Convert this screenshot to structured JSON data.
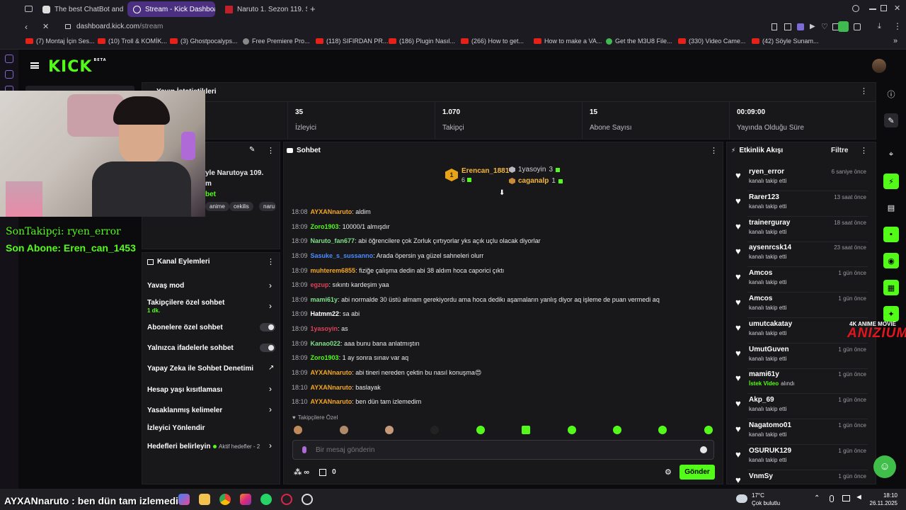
{
  "browser": {
    "tabs": [
      {
        "label": "The best ChatBot and Wi"
      },
      {
        "label": "Stream - Kick Dashboard"
      },
      {
        "label": "Naruto 1. Sezon 119. S"
      }
    ],
    "url_host": "dashboard.kick.com",
    "url_path": "/stream",
    "bookmarks": [
      "(7) Montaj İçin Ses...",
      "(10) Troll & KOMİK...",
      "(3) Ghostpocalyps...",
      "Free Premiere Pro...",
      "(118) SIFIRDAN PR...",
      "(186) Plugin Nasıl...",
      "(266) How to get...",
      "How to make a VA...",
      "Get the M3U8 File...",
      "(330) Video Came...",
      "(42) Söyle Sunam..."
    ]
  },
  "kick": {
    "logo": "KICK",
    "logo_beta": "BETA"
  },
  "stats": {
    "title": "Yayın İstatistikleri",
    "items": [
      {
        "value": "35",
        "label": "İzleyici"
      },
      {
        "value": "1.070",
        "label": "Takipçi"
      },
      {
        "value": "15",
        "label": "Abone Sayısı"
      },
      {
        "value": "00:09:00",
        "label": "Yayında Olduğu Süre"
      }
    ]
  },
  "stream_info": {
    "title_part": "yle Narutoya 109.",
    "title_part2": "m",
    "category_part": "bet",
    "tags": [
      "anime",
      "cekilis",
      "naru"
    ]
  },
  "overlay": {
    "last_follower": "SonTakipçi: ryen_error",
    "last_sub": "Son Abone: Eren_can_1453",
    "last_chat": "AYXANnaruto : ben dün tam izlemedim"
  },
  "chat": {
    "title": "Sohbet",
    "leaders": [
      {
        "rank": "1",
        "name": "Erencan_1881",
        "count": "6"
      },
      {
        "name": "1yasoyin",
        "count": "3"
      },
      {
        "name": "caganalp",
        "count": "1"
      }
    ],
    "messages": [
      {
        "time": "18:08",
        "user": "AYXANnaruto",
        "color": "#f5a623",
        "text": "aldim"
      },
      {
        "time": "18:09",
        "user": "Zoro1903",
        "color": "#53fc18",
        "text": "10000/1 almışdır"
      },
      {
        "time": "18:09",
        "user": "Naruto_fan677",
        "color": "#7ee08a",
        "text": "abi öğrencilere çok Zorluk çırtıyorlar yks açık uçlu olacak diyorlar"
      },
      {
        "time": "18:09",
        "user": "Sasuke_s_sussanno",
        "color": "#4a8cff",
        "text": "Arada öpersin ya güzel sahneleri olurr"
      },
      {
        "time": "18:09",
        "user": "muhterem6855",
        "color": "#f5a623",
        "text": "fiziğe çalışma dedin abi 38 aldım hoca caporici çıktı"
      },
      {
        "time": "18:09",
        "user": "egzup",
        "color": "#e0405a",
        "text": "sıkıntı kardeşim yaa"
      },
      {
        "time": "18:09",
        "user": "mami61y",
        "color": "#7ee08a",
        "text": "abi normalde 30 üstü almam gerekiyordu ama hoca dedikı aşamaların yanlış diyor aq işleme de puan vermedi aq"
      },
      {
        "time": "18:09",
        "user": "Hatmm22",
        "color": "#ffffff",
        "text": "sa abi"
      },
      {
        "time": "18:09",
        "user": "1yasoyin",
        "color": "#e0405a",
        "text": "as"
      },
      {
        "time": "18:09",
        "user": "Kanao022",
        "color": "#7ee08a",
        "text": "aaa bunu bana anlatmıştın"
      },
      {
        "time": "18:09",
        "user": "Zoro1903",
        "color": "#53fc18",
        "text": "1 ay sonra sınav var aq"
      },
      {
        "time": "18:09",
        "user": "AYXANnaruto",
        "color": "#f5a623",
        "text": "abi tineri nereden çektin bu nasıl konuşma😍"
      },
      {
        "time": "18:10",
        "user": "AYXANnaruto",
        "color": "#f5a623",
        "text": "baslayak"
      },
      {
        "time": "18:10",
        "user": "AYXANnaruto",
        "color": "#f5a623",
        "text": "ben dün tam izlemedim"
      }
    ],
    "followers_only": "Takipçilere Özel",
    "placeholder": "Bir mesaj gönderin",
    "points": "0",
    "send": "Gönder"
  },
  "actions": {
    "title": "Kanal Eylemleri",
    "items": [
      {
        "label": "Yavaş mod"
      },
      {
        "label": "Takipçilere özel sohbet",
        "sub": "1 dk."
      },
      {
        "label": "Abonelere özel sohbet"
      },
      {
        "label": "Yalnızca ifadelerle sohbet"
      },
      {
        "label": "Yapay Zeka ile Sohbet Denetimi"
      },
      {
        "label": "Hesap yaşı kısıtlaması"
      },
      {
        "label": "Yasaklanmış kelimeler"
      },
      {
        "label": "İzleyici Yönlendir"
      },
      {
        "label": "Hedefleri belirleyin",
        "sub": "Aktif hedefler - 2"
      }
    ]
  },
  "feed": {
    "title": "Etkinlik Akışı",
    "filter": "Filtre",
    "items": [
      {
        "name": "ryen_error",
        "desc": "kanalı takip etti",
        "time": "6 saniye önce"
      },
      {
        "name": "Rarer123",
        "desc": "kanalı takip etti",
        "time": "13 saat önce"
      },
      {
        "name": "trainerguray",
        "desc": "kanalı takip etti",
        "time": "18 saat önce"
      },
      {
        "name": "aysenrcsk14",
        "desc": "kanalı takip etti",
        "time": "23 saat önce"
      },
      {
        "name": "Amcos",
        "desc": "kanalı takip etti",
        "time": "1 gün önce"
      },
      {
        "name": "Amcos",
        "desc": "kanalı takip etti",
        "time": "1 gün önce"
      },
      {
        "name": "umutcakatay",
        "desc": "kanalı takip etti",
        "time": ""
      },
      {
        "name": "UmutGuven",
        "desc": "kanalı takip etti",
        "time": "1 gün önce"
      },
      {
        "name": "mami61y",
        "desc_green": "İstek Video",
        "desc": "alındı",
        "time": "1 gün önce"
      },
      {
        "name": "Akp_69",
        "desc": "kanalı takip etti",
        "time": "1 gün önce"
      },
      {
        "name": "Nagatomo01",
        "desc": "kanalı takip etti",
        "time": "1 gün önce"
      },
      {
        "name": "OSURUK129",
        "desc": "kanalı takip etti",
        "time": "1 gün önce"
      },
      {
        "name": "VnmSy",
        "desc": "",
        "time": "1 gün önce"
      }
    ]
  },
  "watermark": {
    "top": "4K ANIME MOVIE",
    "brand": "ANIZIUM"
  },
  "taskbar": {
    "temp": "17°C",
    "weather": "Çok bulutlu",
    "time": "18:10",
    "date": "26.11.2025"
  },
  "colors": {
    "kick_green": "#53fc18",
    "panel": "#18181b",
    "active_tab": "#4b2f80"
  }
}
